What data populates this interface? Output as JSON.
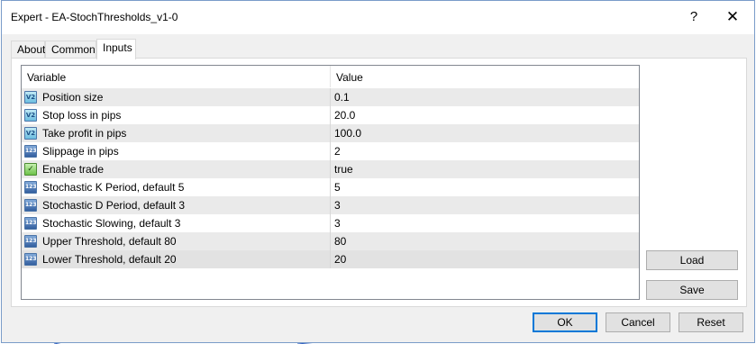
{
  "window": {
    "title": "Expert - EA-StochThresholds_v1-0",
    "help_label": "?",
    "close_label": "✕"
  },
  "tabs": [
    {
      "label": "About",
      "active": false
    },
    {
      "label": "Common",
      "active": false
    },
    {
      "label": "Inputs",
      "active": true
    }
  ],
  "grid": {
    "columns": [
      "Variable",
      "Value"
    ],
    "rows": [
      {
        "icon": "double-type-icon",
        "icon_text": "V2",
        "variable": "Position size",
        "value": "0.1"
      },
      {
        "icon": "double-type-icon",
        "icon_text": "V2",
        "variable": "Stop loss in pips",
        "value": "20.0"
      },
      {
        "icon": "double-type-icon",
        "icon_text": "V2",
        "variable": "Take profit in pips",
        "value": "100.0"
      },
      {
        "icon": "integer-type-icon",
        "icon_text": "123",
        "variable": "Slippage in pips",
        "value": "2"
      },
      {
        "icon": "bool-type-icon",
        "icon_text": "✓",
        "variable": "Enable trade",
        "value": "true"
      },
      {
        "icon": "integer-type-icon",
        "icon_text": "123",
        "variable": "Stochastic K Period, default 5",
        "value": "5"
      },
      {
        "icon": "integer-type-icon",
        "icon_text": "123",
        "variable": "Stochastic D Period, default 3",
        "value": "3"
      },
      {
        "icon": "integer-type-icon",
        "icon_text": "123",
        "variable": "Stochastic Slowing, default 3",
        "value": "3"
      },
      {
        "icon": "integer-type-icon",
        "icon_text": "123",
        "variable": "Upper Threshold, default 80",
        "value": "80"
      },
      {
        "icon": "integer-type-icon",
        "icon_text": "123",
        "variable": "Lower Threshold, default 20",
        "value": "20"
      }
    ]
  },
  "side_buttons": {
    "load": "Load",
    "save": "Save"
  },
  "bottom_buttons": {
    "ok": "OK",
    "cancel": "Cancel",
    "reset": "Reset"
  }
}
